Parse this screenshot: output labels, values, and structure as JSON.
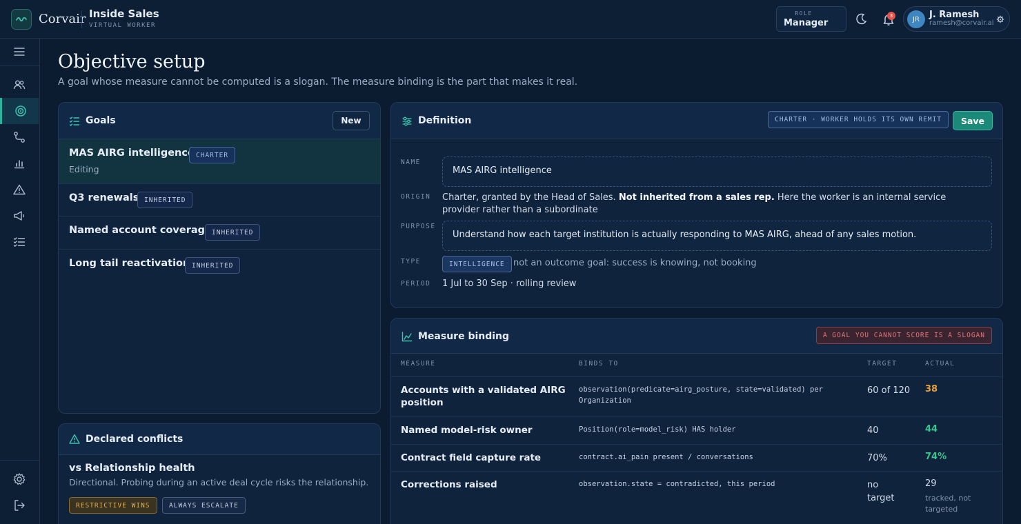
{
  "header": {
    "brand": "Corvair",
    "app_title": "Inside Sales",
    "app_subtitle": "VIRTUAL WORKER",
    "role_label": "ROLE",
    "role_value": "Manager",
    "notifications": "3",
    "user_initials": "JR",
    "user_name": "J. Ramesh",
    "user_email": "ramesh@corvair.ai"
  },
  "sidebar": {
    "items": [
      "menu-icon",
      "people-icon",
      "target-icon",
      "route-icon",
      "bar-chart-icon",
      "alert-icon",
      "megaphone-icon",
      "checklist-icon"
    ],
    "footer": [
      "gear-icon",
      "logout-icon"
    ],
    "active": "target-icon"
  },
  "page": {
    "title": "Objective setup",
    "subtitle": "A goal whose measure cannot be computed is a slogan. The measure binding is the part that makes it real."
  },
  "goals": {
    "title": "Goals",
    "new_label": "New",
    "items": [
      {
        "name": "MAS AIRG intelligence",
        "tag": "CHARTER",
        "note": "Editing"
      },
      {
        "name": "Q3 renewals",
        "tag": "INHERITED"
      },
      {
        "name": "Named account coverage",
        "tag": "INHERITED"
      },
      {
        "name": "Long tail reactivation",
        "tag": "INHERITED"
      }
    ]
  },
  "conflicts": {
    "title": "Declared conflicts",
    "items": [
      {
        "name": "vs Relationship health",
        "desc": "Directional. Probing during an active deal cycle risks the relationship.",
        "tag1": "RESTRICTIVE WINS",
        "tag2": "ALWAYS ESCALATE"
      }
    ]
  },
  "definition": {
    "title": "Definition",
    "charter_tag": "CHARTER · WORKER HOLDS ITS OWN REMIT",
    "save_label": "Save",
    "name_label": "NAME",
    "name_value": "MAS AIRG intelligence",
    "origin_label": "ORIGIN",
    "origin_pre": "Charter, granted by the Head of Sales. ",
    "origin_bold": "Not inherited from a sales rep.",
    "origin_post": " Here the worker is an internal service provider rather than a subordinate",
    "purpose_label": "PURPOSE",
    "purpose_value": "Understand how each target institution is actually responding to MAS AIRG, ahead of any sales motion.",
    "type_label": "TYPE",
    "type_tag": "INTELLIGENCE",
    "type_note": "not an outcome goal: success is knowing, not booking",
    "period_label": "PERIOD",
    "period_value": "1 Jul to 30 Sep · rolling review"
  },
  "measure": {
    "title": "Measure binding",
    "warning_tag": "A GOAL YOU CANNOT SCORE IS A SLOGAN",
    "columns": {
      "measure": "MEASURE",
      "binds": "BINDS TO",
      "target": "TARGET",
      "actual": "ACTUAL"
    },
    "rows": [
      {
        "measure": "Accounts with a validated AIRG position",
        "binds": "observation(predicate=airg_posture, state=validated) per Organization",
        "target": "60 of 120",
        "actual": "38",
        "actual_color": "#e7a13d"
      },
      {
        "measure": "Named model-risk owner",
        "binds": "Position(role=model_risk) HAS holder",
        "target": "40",
        "actual": "44",
        "actual_color": "#3cc48f"
      },
      {
        "measure": "Contract field capture rate",
        "binds": "contract.ai_pain present / conversations",
        "target": "70%",
        "actual": "74%",
        "actual_color": "#3cc48f"
      },
      {
        "measure": "Corrections raised",
        "binds": "observation.state = contradicted, this period",
        "target": "no target",
        "actual": "29",
        "actual_color": "#d3dde9",
        "actual_note": "tracked, not targeted"
      }
    ]
  },
  "colors": {
    "accent": "#2bb3a0",
    "save": "#1b8a78",
    "warning": "#e2737a",
    "amber": "#e7a13d",
    "good": "#3cc48f"
  }
}
